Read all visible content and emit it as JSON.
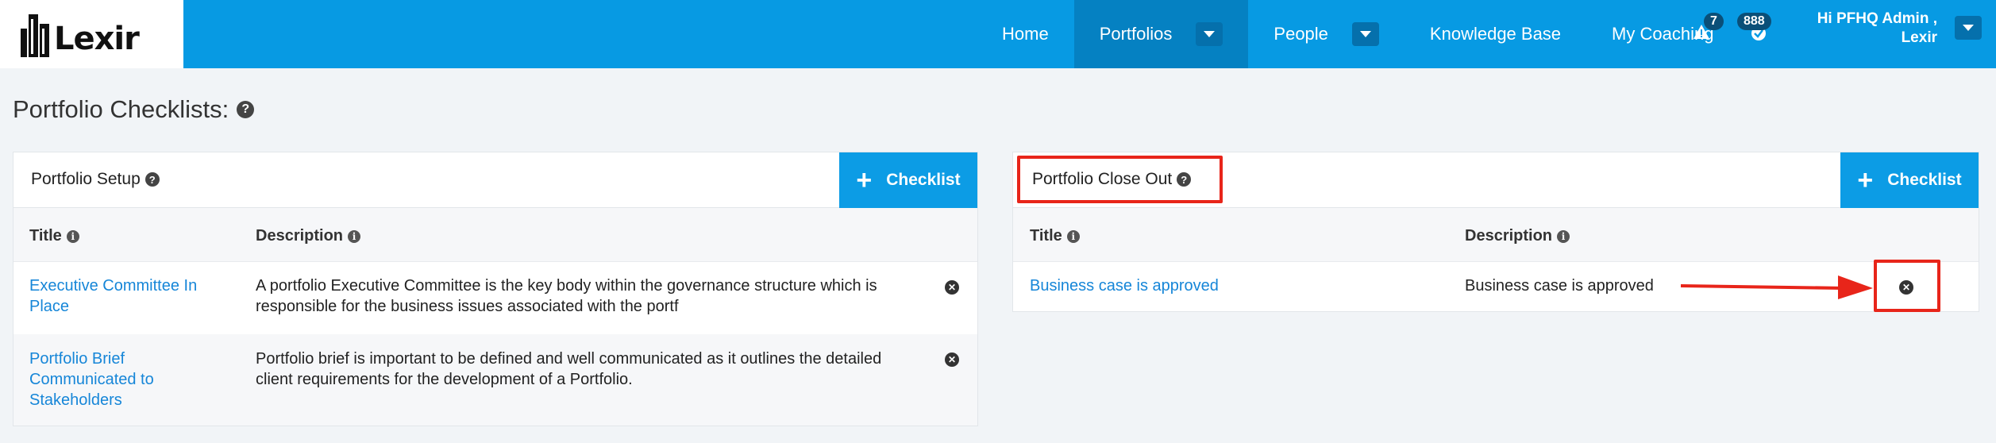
{
  "app": {
    "logo_text": "Lexir"
  },
  "nav": {
    "items": [
      {
        "label": "Home"
      },
      {
        "label": "Portfolios"
      },
      {
        "label": "People"
      },
      {
        "label": "Knowledge Base"
      },
      {
        "label": "My Coaching"
      }
    ],
    "alerts_count": "7",
    "tasks_count": "888",
    "user_greeting": "Hi PFHQ Admin ,",
    "user_org": "Lexir"
  },
  "page": {
    "title": "Portfolio Checklists:"
  },
  "panels": [
    {
      "title": "Portfolio Setup",
      "add_label": "Checklist",
      "columns": {
        "title": "Title",
        "description": "Description"
      },
      "rows": [
        {
          "title_lines": [
            "Executive Committee In",
            "Place"
          ],
          "desc_lines": [
            "A portfolio Executive Committee is the key body within the governance structure which is",
            "responsible for the business issues associated with the portf"
          ]
        },
        {
          "title_lines": [
            "Portfolio Brief",
            "Communicated to",
            "Stakeholders"
          ],
          "desc_lines": [
            "Portfolio brief is important to be defined and well communicated as it outlines the detailed",
            "client requirements for the development of a Portfolio."
          ]
        }
      ]
    },
    {
      "title": "Portfolio Close Out",
      "add_label": "Checklist",
      "columns": {
        "title": "Title",
        "description": "Description"
      },
      "rows": [
        {
          "title_lines": [
            "Business case is approved"
          ],
          "desc_lines": [
            "Business case is approved"
          ]
        }
      ]
    }
  ],
  "colors": {
    "nav_bg": "#079ae3",
    "nav_active": "#0581c2",
    "button": "#0c9ce5",
    "link": "#1686d8",
    "annotation": "#e8251a"
  },
  "icons": {
    "help": "question-circle-icon",
    "info": "info-circle-icon",
    "remove": "times-circle-icon",
    "alert": "warning-icon",
    "tasks": "check-icon"
  }
}
